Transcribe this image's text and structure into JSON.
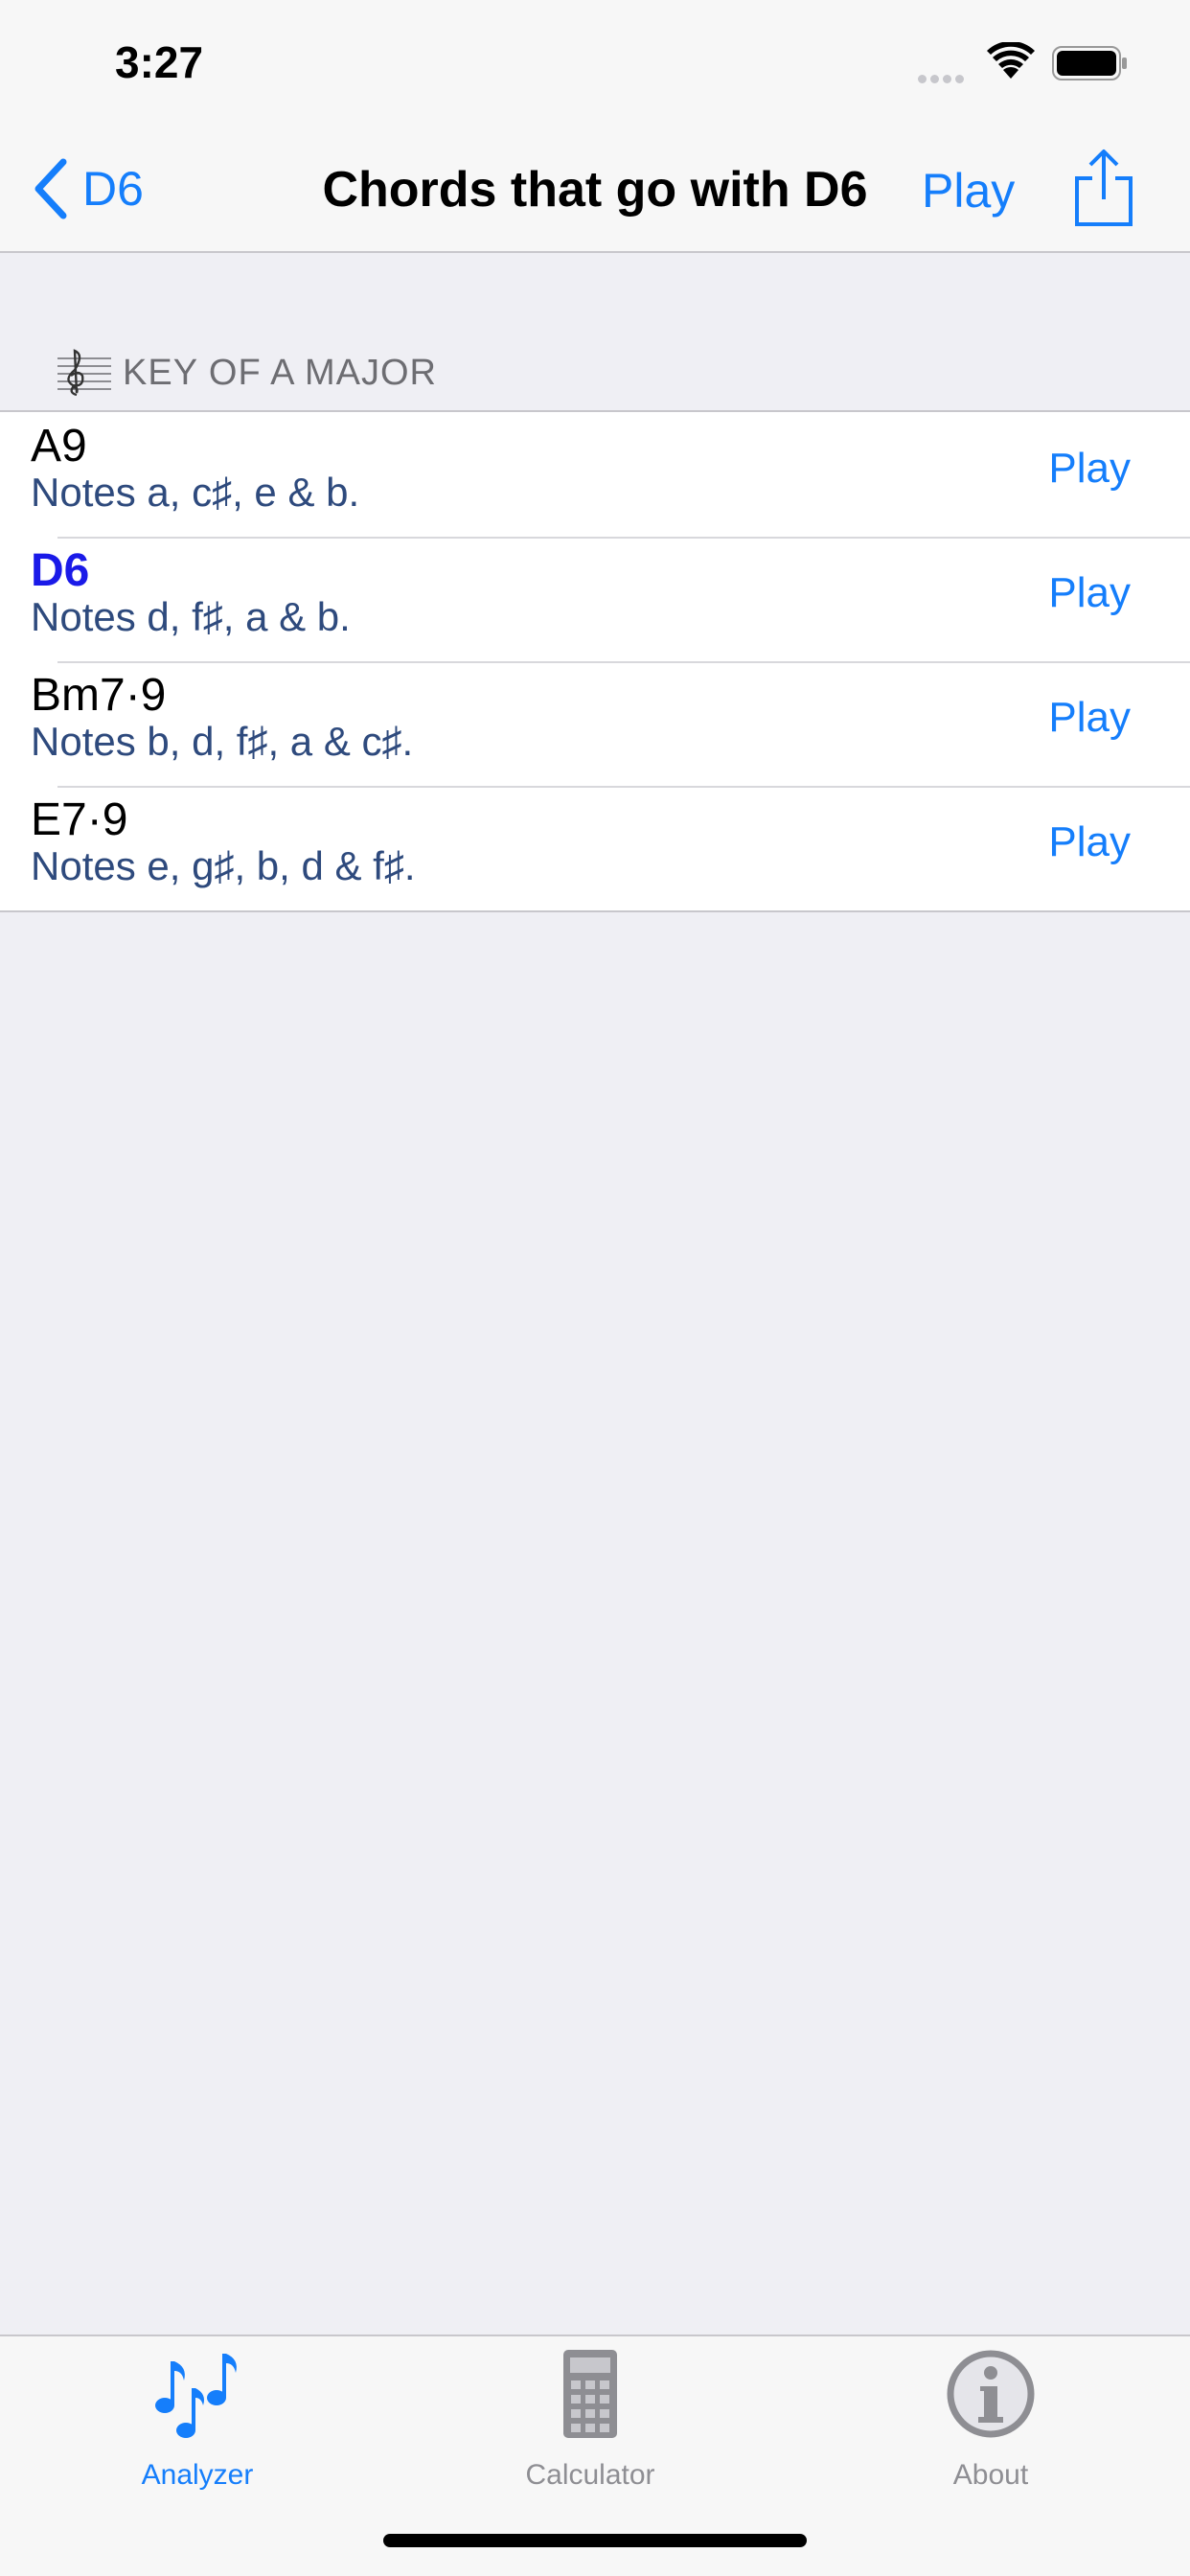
{
  "status_bar": {
    "time": "3:27"
  },
  "nav": {
    "back_label": "D6",
    "title": "Chords that go with D6",
    "play_label": "Play"
  },
  "section": {
    "label": "KEY OF A MAJOR"
  },
  "chords": [
    {
      "name": "A9",
      "notes": "Notes  a, c♯, e & b.",
      "play": "Play"
    },
    {
      "name": "D6",
      "notes": "Notes  d, f♯, a & b.",
      "play": "Play",
      "current": true
    },
    {
      "name": "Bm7·9",
      "notes": "Notes  b, d, f♯, a & c♯.",
      "play": "Play"
    },
    {
      "name": "E7·9",
      "notes": "Notes  e, g♯, b, d & f♯.",
      "play": "Play"
    }
  ],
  "tabs": [
    {
      "label": "Analyzer",
      "icon": "music-notes-icon",
      "selected": true
    },
    {
      "label": "Calculator",
      "icon": "calculator-icon"
    },
    {
      "label": "About",
      "icon": "info-icon"
    }
  ],
  "colors": {
    "accent": "#157efb",
    "current_chord": "#1a1ae8",
    "notes_text": "#2e4a7d"
  }
}
